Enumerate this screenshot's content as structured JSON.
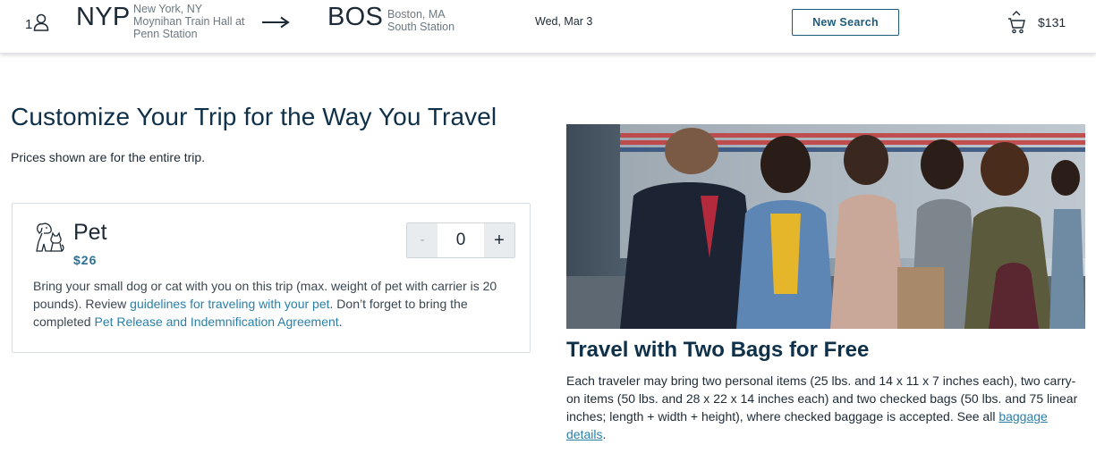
{
  "header": {
    "passengers": "1",
    "origin": {
      "code": "NYP",
      "city": "New York, NY",
      "station": "Moynihan Train Hall at Penn Station"
    },
    "destination": {
      "code": "BOS",
      "city": "Boston, MA",
      "station": "South Station"
    },
    "date": "Wed, Mar 3",
    "new_search_label": "New Search",
    "cart_total": "$131",
    "icons": {
      "passenger": "person-icon",
      "direction": "arrow-right-icon",
      "cart": "cart-icon"
    }
  },
  "main": {
    "title": "Customize Your Trip for the Way You Travel",
    "subtitle": "Prices shown are for the entire trip."
  },
  "pet_card": {
    "name": "Pet",
    "price": "$26",
    "quantity": "0",
    "minus_label": "-",
    "plus_label": "+",
    "icon": "pet-icon",
    "desc_before": "Bring your small dog or cat with you on this trip (max. weight of pet with carrier is 20 pounds). Review ",
    "link1": "guidelines for traveling with your pet",
    "desc_middle": ". Don’t forget to bring the completed ",
    "link2": "Pet Release and Indemnification Agreement",
    "desc_after": "."
  },
  "bags": {
    "title": "Travel with Two Bags for Free",
    "desc_before": "Each traveler may bring two personal items (25 lbs. and 14 x 11 x 7 inches each), two carry-on items (50 lbs. and 28 x 22 x 14 inches each) and two checked bags (50 lbs. and 75 linear inches; length + width + height), where checked baggage is accepted. See all ",
    "link": "baggage details",
    "desc_after": "."
  },
  "colors": {
    "accent": "#1d5a7a",
    "link": "#2a7fa8",
    "heading": "#0f3049",
    "price": "#2a6f92"
  }
}
